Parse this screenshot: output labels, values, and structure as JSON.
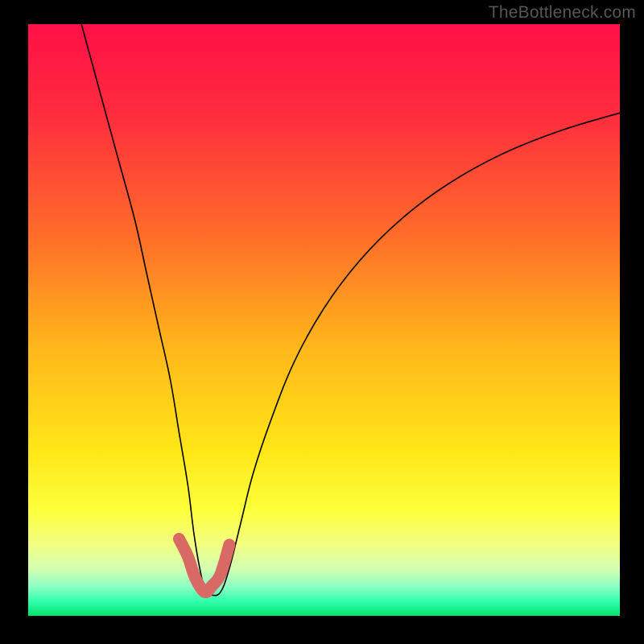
{
  "watermark": "TheBottleneck.com",
  "chart_data": {
    "type": "line",
    "title": "",
    "xlabel": "",
    "ylabel": "",
    "xlim": [
      0,
      100
    ],
    "ylim": [
      0,
      100
    ],
    "series": [
      {
        "name": "bottleneck-curve",
        "x": [
          9,
          12,
          15,
          18,
          20,
          22,
          24,
          25.5,
          27,
          28,
          29,
          30,
          31,
          32.5,
          34,
          36,
          38,
          41,
          45,
          50,
          56,
          63,
          71,
          80,
          90,
          100
        ],
        "y": [
          100,
          89,
          78,
          67,
          58,
          49,
          40,
          31,
          22,
          14,
          8,
          4,
          3.5,
          4,
          8,
          16,
          24,
          33,
          43,
          52,
          60,
          67,
          73,
          78,
          82,
          85
        ]
      },
      {
        "name": "highlight-segment",
        "x": [
          25.5,
          27,
          28,
          29,
          30,
          31,
          32.5,
          34
        ],
        "y": [
          13,
          10,
          7,
          5,
          4,
          5,
          7,
          12
        ]
      }
    ],
    "gradient_stops": [
      {
        "offset": 0.0,
        "color": "#ff1047"
      },
      {
        "offset": 0.15,
        "color": "#ff2c3e"
      },
      {
        "offset": 0.35,
        "color": "#ff6a2a"
      },
      {
        "offset": 0.55,
        "color": "#ffb81a"
      },
      {
        "offset": 0.72,
        "color": "#ffe617"
      },
      {
        "offset": 0.82,
        "color": "#fdff3a"
      },
      {
        "offset": 0.88,
        "color": "#f2ff83"
      },
      {
        "offset": 0.92,
        "color": "#d3ffb0"
      },
      {
        "offset": 0.95,
        "color": "#8effc4"
      },
      {
        "offset": 0.975,
        "color": "#33ffad"
      },
      {
        "offset": 1.0,
        "color": "#00e36e"
      }
    ],
    "colors": {
      "curve": "#000000",
      "highlight": "#d96965"
    }
  }
}
